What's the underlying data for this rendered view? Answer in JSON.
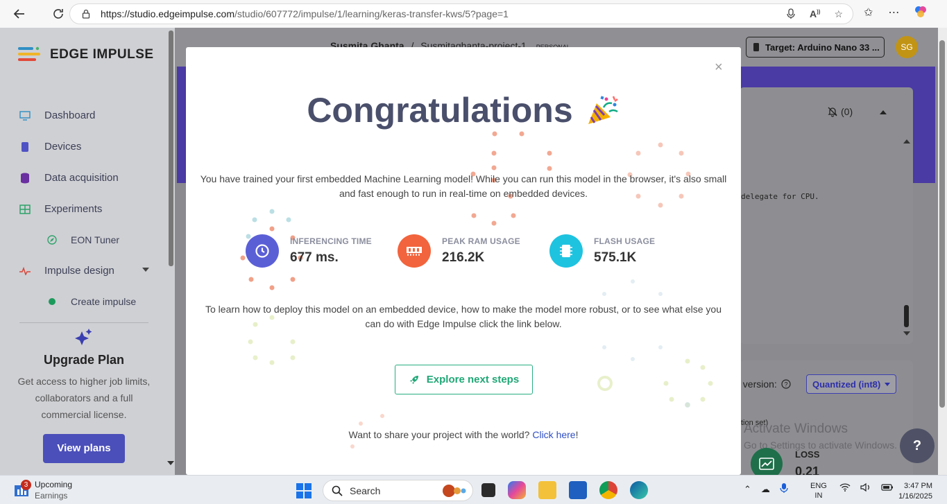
{
  "browser": {
    "url_host": "https://studio.edgeimpulse.com",
    "url_rest": "/studio/607772/impulse/1/learning/keras-transfer-kws/5?page=1"
  },
  "sidebar": {
    "logo_text": "EDGE IMPULSE",
    "items": [
      {
        "label": "Dashboard"
      },
      {
        "label": "Devices"
      },
      {
        "label": "Data acquisition"
      },
      {
        "label": "Experiments"
      },
      {
        "label": "EON Tuner"
      },
      {
        "label": "Impulse design"
      },
      {
        "label": "Create impulse"
      }
    ],
    "upgrade": {
      "title": "Upgrade Plan",
      "desc": "Get access to higher job limits, collaborators and a full commercial license.",
      "button": "View plans"
    }
  },
  "header": {
    "user": "Susmita Ghanta",
    "separator": "/",
    "project": "Susmitaghanta-project-1",
    "badge": "PERSONAL",
    "target": "Target: Arduino Nano 33 ...",
    "avatar": "SG"
  },
  "background": {
    "notifications": "(0)",
    "log_text": "delegate for CPU.",
    "model_version_label": "el version:",
    "model_version_value": "Quantized (int8)",
    "validation_text": "tion set)",
    "loss_label": "LOSS",
    "loss_value": "0.21",
    "help": "?",
    "activate_title": "Activate Windows",
    "activate_sub": "Go to Settings to activate Windows."
  },
  "modal": {
    "close": "×",
    "title": "Congratulations",
    "intro": "You have trained your first embedded Machine Learning model! While you can run this model in the browser, it's also small and fast enough to run in real-time on embedded devices.",
    "stats": [
      {
        "label": "INFERENCING TIME",
        "value": "677 ms.",
        "color": "#5b5fd6"
      },
      {
        "label": "PEAK RAM USAGE",
        "value": "216.2K",
        "color": "#f2643d"
      },
      {
        "label": "FLASH USAGE",
        "value": "575.1K",
        "color": "#1ec3e0"
      }
    ],
    "learn": "To learn how to deploy this model on an embedded device, how to make the model more robust, or to see what else you can do with Edge Impulse click the link below.",
    "explore_button": "Explore next steps",
    "share_text": "Want to share your project with the world?",
    "share_link": "Click here",
    "share_end": "!"
  },
  "taskbar": {
    "notif_count": "3",
    "weather_title": "Upcoming",
    "weather_sub": "Earnings",
    "search": "Search",
    "lang_top": "ENG",
    "lang_bottom": "IN",
    "time": "3:47 PM",
    "date": "1/16/2025"
  }
}
